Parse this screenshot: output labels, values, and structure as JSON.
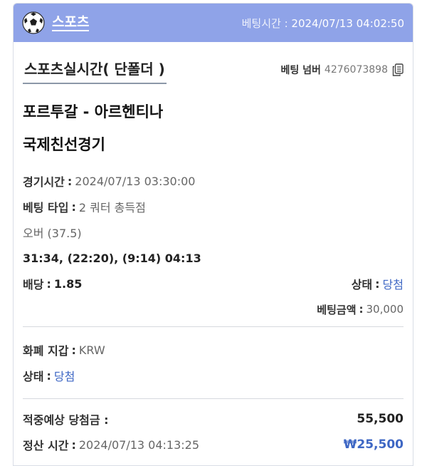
{
  "header": {
    "sport_label": "스포츠",
    "bet_time_label": "베팅시간",
    "bet_time_value": "2024/07/13 04:02:50",
    "ball_icon": "soccer-ball-icon"
  },
  "bet": {
    "type_title": "스포츠실시간( 단폴더 )",
    "bet_number_label": "베팅 넘버",
    "bet_number": "4276073898",
    "copy_icon": "copy-icon"
  },
  "match": {
    "teams": "포르투갈 - 아르헨티나",
    "league": "국제친선경기"
  },
  "details": {
    "game_time_label": "경기시간",
    "game_time_value": "2024/07/13 03:30:00",
    "bet_type_label": "베팅 타입",
    "bet_type_value": "2 쿼터 총득점",
    "selection": "오버 (37.5)",
    "score": "31:34, (22:20), (9:14) 04:13",
    "odds_label": "배당",
    "odds_value": "1.85",
    "status_label": "상태",
    "status_value": "당첨",
    "bet_amount_label": "베팅금액",
    "bet_amount_value": "30,000"
  },
  "wallet": {
    "currency_label": "화폐 지갑",
    "currency_value": "KRW",
    "status_label": "상태",
    "status_value": "당첨"
  },
  "payout": {
    "expected_label": "적중예상 당첨금 :",
    "expected_value": "55,500",
    "settle_label": "정산 시간",
    "settle_value": "2024/07/13 04:13:25",
    "settle_amount": "₩25,500"
  },
  "colors": {
    "header_bg": "#8fa3e8",
    "accent_blue": "#3e67c4"
  }
}
